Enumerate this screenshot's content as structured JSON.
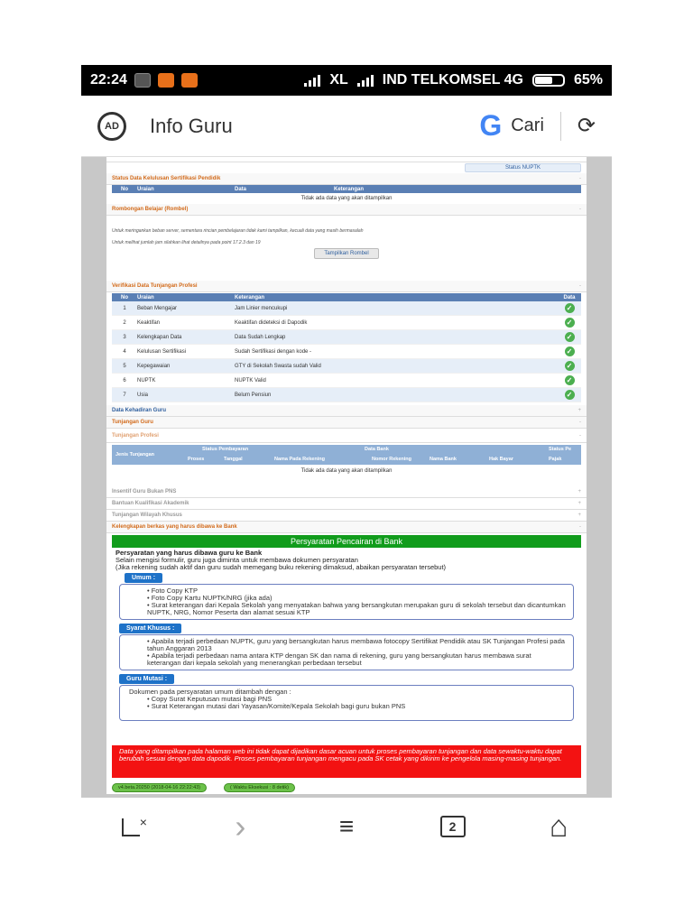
{
  "status_bar": {
    "time": "22:24",
    "carrier1": "XL",
    "carrier2": "IND TELKOMSEL 4G",
    "battery": "65%",
    "battery_level": 0.65
  },
  "app_bar": {
    "title": "Info Guru",
    "ad_label": "AD",
    "google_label": "G",
    "search_label": "Cari",
    "refresh_symbol": "⟳"
  },
  "top_link": "Status NUPTK",
  "sertifikasi": {
    "title": "Status Data Kelulusan Sertifikasi Pendidik",
    "columns": [
      "No",
      "Uraian",
      "Data",
      "Keterangan"
    ],
    "empty": "Tidak ada data yang akan ditampilkan"
  },
  "rombel": {
    "title": "Rombongan Belajar (Rombel)",
    "note1": "Untuk meringankan beban server, sementara rincian pembelajaran tidak kami tampilkan, kecuali data yang masih bermasalah",
    "note2": "Untuk melihat jumlah jam silahkan lihat detailnya pada point 17.2.3 dan 19",
    "button": "Tampilkan Rombel"
  },
  "verifikasi": {
    "title": "Verifikasi Data Tunjangan Profesi",
    "columns": [
      "No",
      "Uraian",
      "Keterangan",
      "Data"
    ],
    "rows": [
      {
        "no": "1",
        "uraian": "Beban Mengajar",
        "ket": "Jam Linier mencukupi"
      },
      {
        "no": "2",
        "uraian": "Keaktifan",
        "ket": "Keaktifan dideteksi di Dapodik"
      },
      {
        "no": "3",
        "uraian": "Kelengkapan Data",
        "ket": "Data Sudah Lengkap"
      },
      {
        "no": "4",
        "uraian": "Kelulusan Sertifikasi",
        "ket": "Sudah Sertifikasi dengan kode -"
      },
      {
        "no": "5",
        "uraian": "Kepegawaian",
        "ket": "GTY di Sekolah Swasta sudah Valid"
      },
      {
        "no": "6",
        "uraian": "NUPTK",
        "ket": "NUPTK Valid"
      },
      {
        "no": "7",
        "uraian": "Usia",
        "ket": "Belum Pensiun"
      }
    ]
  },
  "sections": {
    "kehadiran": "Data Kehadiran Guru",
    "tunjangan_guru": "Tunjangan Guru",
    "tunjangan_profesi": "Tunjangan Profesi",
    "insentif": "Insentif Guru Bukan PNS",
    "bantuan": "Bantuan Kualifikasi Akademik",
    "wilayah": "Tunjangan Wilayah Khusus",
    "kelengkapan": "Kelengkapan berkas yang harus dibawa ke Bank"
  },
  "tunjangan_table": {
    "col_jenis": "Jenis Tunjangan",
    "col_status_pembayaran": "Status Pembayaran",
    "col_proses": "Proses",
    "col_tanggal": "Tanggal",
    "col_data_bank": "Data Bank",
    "col_nama_rek": "Nama Pada Rekening",
    "col_nomor_rek": "Nomor Rekening",
    "col_nama_bank": "Nama Bank",
    "col_hak_bayar": "Hak Bayar",
    "col_status_pajak": "Status Pe",
    "col_pajak": "Pajak",
    "empty": "Tidak ada data yang akan ditampilkan"
  },
  "persyaratan": {
    "header": "Persyaratan Pencairan di Bank",
    "heading": "Persyaratan yang harus dibawa guru ke Bank",
    "intro1": "Selain mengisi formulir, guru juga diminta untuk membawa dokumen persyaratan",
    "intro2": "(Jika rekening sudah aktif dan guru sudah memegang buku rekening dimaksud, abaikan persyaratan tersebut)",
    "umum_label": "Umum :",
    "umum_items": [
      "Foto Copy KTP",
      "Foto Copy Kartu NUPTK/NRG (jika ada)",
      "Surat keterangan dari Kepala Sekolah yang menyatakan bahwa yang bersangkutan merupakan guru di sekolah tersebut dan dicantumkan NUPTK, NRG, Nomor Peserta dan alamat sesuai KTP"
    ],
    "khusus_label": "Syarat Khusus :",
    "khusus_items": [
      "Apabila terjadi perbedaan NUPTK, guru yang bersangkutan harus membawa fotocopy Sertifikat Pendidik atau SK Tunjangan Profesi pada tahun Anggaran 2013",
      "Apabila terjadi perbedaan nama antara KTP dengan SK dan nama di rekening, guru yang bersangkutan harus membawa surat keterangan dari kepala sekolah yang menerangkan perbedaan tersebut"
    ],
    "mutasi_label": "Guru Mutasi :",
    "mutasi_intro": "Dokumen pada persyaratan umum ditambah dengan :",
    "mutasi_items": [
      "Copy Surat Keputusan mutasi bagi PNS",
      "Surat Keterangan mutasi dari Yayasan/Komite/Kepala Sekolah bagi guru bukan PNS"
    ]
  },
  "warning": "Data yang ditampilkan pada halaman web ini tidak dapat dijadikan dasar acuan untuk proses pembayaran tunjangan dan data sewaktu-waktu dapat berubah sesuai dengan data dapodik. Proses pembayaran tunjangan mengacu pada SK cetak yang dikirim ke pengelola masing-masing tunjangan.",
  "footer": {
    "version": "v4.beta.20250 (2018-04-16 22:22:43)",
    "waktu": "( Waktu Eksekusi : 8 detik)"
  },
  "nav": {
    "close_tab": "×",
    "forward": "›",
    "menu": "≡",
    "tabs": "2",
    "home": "⌂"
  }
}
